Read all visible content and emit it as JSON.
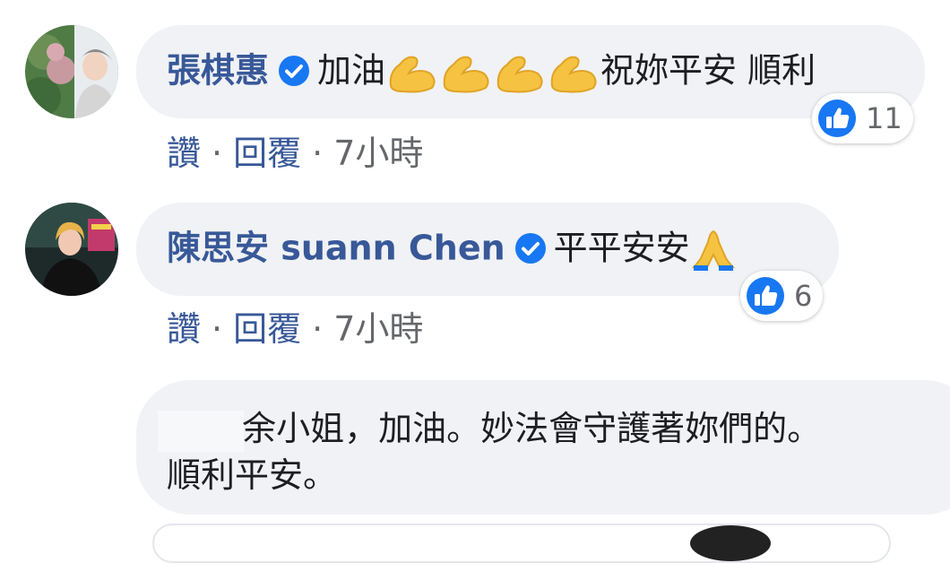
{
  "comments": [
    {
      "author": "張棋惠",
      "verified": true,
      "text_before_emoji": "加油",
      "emoji": "flexed-biceps",
      "emoji_count": 4,
      "text_after_emoji": "祝妳平安 順利",
      "reaction": {
        "icon": "like-icon",
        "count": "11"
      },
      "actions": {
        "like": "讚",
        "reply": "回覆",
        "time": "7小時"
      }
    },
    {
      "author": "陳思安 suann Chen",
      "verified": true,
      "text_before_emoji": "平平安安",
      "emoji": "folded-hands",
      "reaction": {
        "icon": "like-icon",
        "count": "6"
      },
      "actions": {
        "like": "讚",
        "reply": "回覆",
        "time": "7小時"
      }
    },
    {
      "author_hidden": true,
      "line1": "余小姐，加油。妙法會守護著妳們的。",
      "line2": "順利平安。"
    }
  ],
  "colors": {
    "bubble": "#f0f2f5",
    "author": "#385898",
    "verified": "#1877f2",
    "like_blue": "#1877f2",
    "emoji_yellow": "#f5c242"
  },
  "separator": "·"
}
